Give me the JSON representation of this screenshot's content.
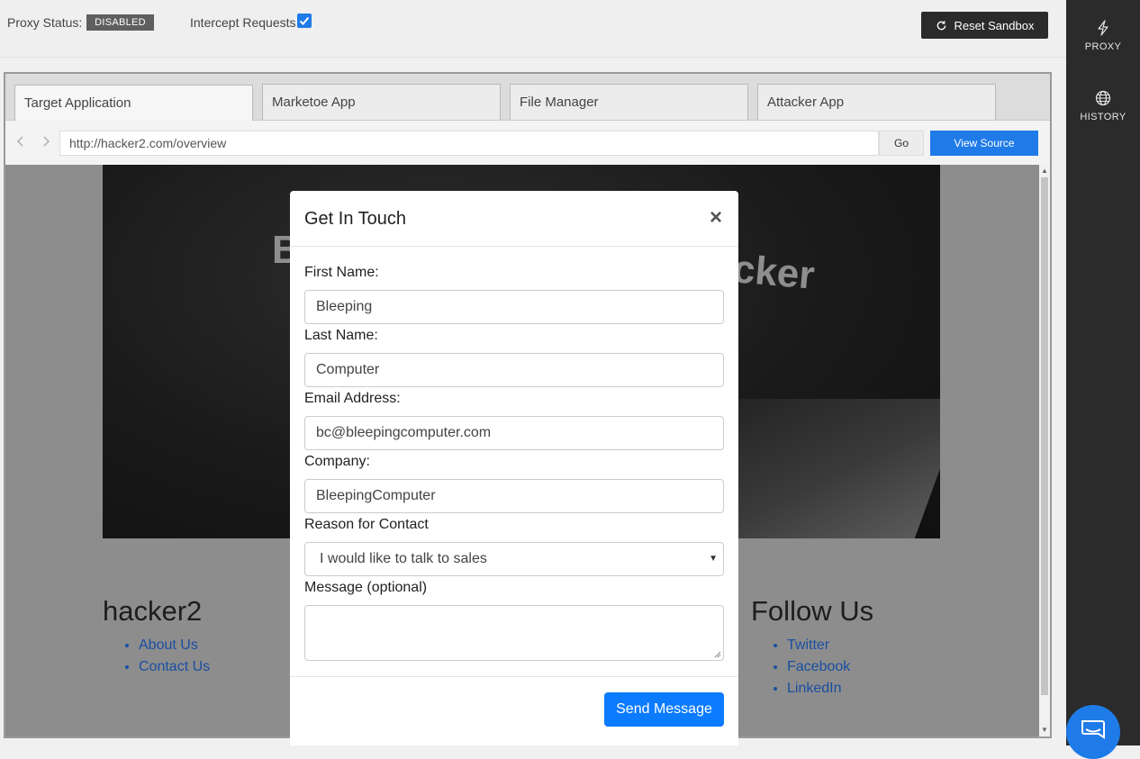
{
  "topbar": {
    "proxy_status_label": "Proxy Status:",
    "proxy_status_value": "DISABLED",
    "intercept_label": "Intercept Requests",
    "intercept_checked": true,
    "reset_label": "Reset Sandbox"
  },
  "sidebar": {
    "items": [
      {
        "label": "PROXY",
        "icon": "bolt-icon"
      },
      {
        "label": "HISTORY",
        "icon": "globe-icon"
      }
    ]
  },
  "browser": {
    "tabs": [
      {
        "label": "Target Application",
        "active": true
      },
      {
        "label": "Marketoe App",
        "active": false
      },
      {
        "label": "File Manager",
        "active": false
      },
      {
        "label": "Attacker App",
        "active": false
      }
    ],
    "url": "http://hacker2.com/overview",
    "go_label": "Go",
    "view_source_label": "View Source"
  },
  "page": {
    "hero_text_left": "B",
    "hero_text_right": "cker",
    "footer_left": {
      "title": "hacker2",
      "links": [
        "About Us",
        "Contact Us"
      ]
    },
    "footer_right": {
      "title": "Follow Us",
      "links": [
        "Twitter",
        "Facebook",
        "LinkedIn"
      ]
    }
  },
  "modal": {
    "title": "Get In Touch",
    "close": "×",
    "fields": {
      "first_name_label": "First Name:",
      "first_name_value": "Bleeping",
      "last_name_label": "Last Name:",
      "last_name_value": "Computer",
      "email_label": "Email Address:",
      "email_value": "bc@bleepingcomputer.com",
      "company_label": "Company:",
      "company_value": "BleepingComputer",
      "reason_label": "Reason for Contact",
      "reason_value": "I would like to talk to sales",
      "message_label": "Message (optional)"
    },
    "send_label": "Send Message"
  },
  "colors": {
    "accent": "#1f7be8",
    "send_button": "#0b7bff",
    "sidebar_bg": "#2b2b2b",
    "badge_bg": "#5f5f5f"
  }
}
